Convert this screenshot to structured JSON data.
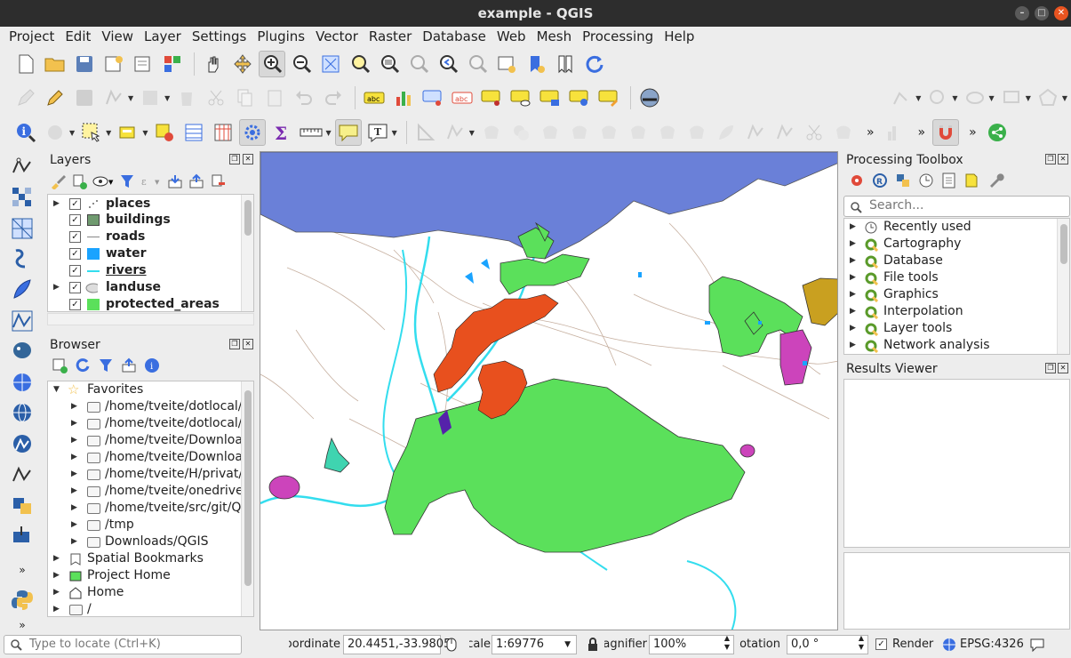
{
  "window": {
    "title": "example - QGIS"
  },
  "menu": [
    "Project",
    "Edit",
    "View",
    "Layer",
    "Settings",
    "Plugins",
    "Vector",
    "Raster",
    "Database",
    "Web",
    "Mesh",
    "Processing",
    "Help"
  ],
  "layers_panel": {
    "title": "Layers",
    "items": [
      {
        "label": "places",
        "checked": true,
        "expandable": true,
        "symbol": "point-dots",
        "bold": true
      },
      {
        "label": "buildings",
        "checked": true,
        "expandable": false,
        "symbol": "fill",
        "color": "#6f9a6f",
        "bold": true
      },
      {
        "label": "roads",
        "checked": true,
        "expandable": false,
        "symbol": "line",
        "color": "#a0a0a0",
        "bold": true
      },
      {
        "label": "water",
        "checked": true,
        "expandable": false,
        "symbol": "fill",
        "color": "#1aa3ff",
        "bold": true
      },
      {
        "label": "rivers",
        "checked": true,
        "expandable": false,
        "symbol": "line",
        "color": "#33ddee",
        "bold": true,
        "underline": true
      },
      {
        "label": "landuse",
        "checked": true,
        "expandable": true,
        "symbol": "rule",
        "bold": true
      },
      {
        "label": "protected_areas",
        "checked": true,
        "expandable": false,
        "symbol": "fill",
        "color": "#5be05b",
        "bold": true
      }
    ]
  },
  "browser_panel": {
    "title": "Browser",
    "items": [
      {
        "label": "Favorites",
        "level": 0,
        "expanded": true,
        "icon": "star-icon"
      },
      {
        "label": "/home/tveite/dotlocal/",
        "level": 1,
        "icon": "folder-icon"
      },
      {
        "label": "/home/tveite/dotlocal/",
        "level": 1,
        "icon": "folder-icon"
      },
      {
        "label": "/home/tveite/Downloa",
        "level": 1,
        "icon": "folder-icon"
      },
      {
        "label": "/home/tveite/Downloa",
        "level": 1,
        "icon": "folder-icon"
      },
      {
        "label": "/home/tveite/H/privat/",
        "level": 1,
        "icon": "folder-icon"
      },
      {
        "label": "/home/tveite/onedrive",
        "level": 1,
        "icon": "folder-icon"
      },
      {
        "label": "/home/tveite/src/git/Q",
        "level": 1,
        "icon": "folder-icon"
      },
      {
        "label": "/tmp",
        "level": 1,
        "icon": "folder-icon"
      },
      {
        "label": "Downloads/QGIS",
        "level": 1,
        "icon": "folder-icon"
      },
      {
        "label": "Spatial Bookmarks",
        "level": 0,
        "icon": "bookmark-icon"
      },
      {
        "label": "Project Home",
        "level": 0,
        "icon": "project-home-icon"
      },
      {
        "label": "Home",
        "level": 0,
        "icon": "home-icon"
      },
      {
        "label": "/",
        "level": 0,
        "icon": "folder-icon"
      }
    ]
  },
  "processing_toolbox": {
    "title": "Processing Toolbox",
    "search_placeholder": "Search...",
    "items": [
      {
        "label": "Recently used",
        "icon": "clock-icon"
      },
      {
        "label": "Cartography",
        "icon": "qgis-q-icon"
      },
      {
        "label": "Database",
        "icon": "qgis-q-icon"
      },
      {
        "label": "File tools",
        "icon": "qgis-q-icon"
      },
      {
        "label": "Graphics",
        "icon": "qgis-q-icon"
      },
      {
        "label": "Interpolation",
        "icon": "qgis-q-icon"
      },
      {
        "label": "Layer tools",
        "icon": "qgis-q-icon"
      },
      {
        "label": "Network analysis",
        "icon": "qgis-q-icon"
      }
    ]
  },
  "results_viewer": {
    "title": "Results Viewer"
  },
  "status": {
    "locate_placeholder": "Type to locate (Ctrl+K)",
    "coordinate_label": "Coordinate",
    "coordinate_value": "20.4451,-33.9805",
    "scale_label": "Scale",
    "scale_value": "1:69776",
    "magnifier_label": "Magnifier",
    "magnifier_value": "100%",
    "rotation_label": "Rotation",
    "rotation_value": "0,0 °",
    "render_label": "Render",
    "render_checked": true,
    "crs": "EPSG:4326"
  },
  "colors": {
    "protected_areas": "#5be05b",
    "urban": "#e8501e",
    "water_blue": "#6a7fd8",
    "rivers": "#33ddee",
    "magenta": "#cc44bb",
    "mustard": "#c9a020"
  }
}
